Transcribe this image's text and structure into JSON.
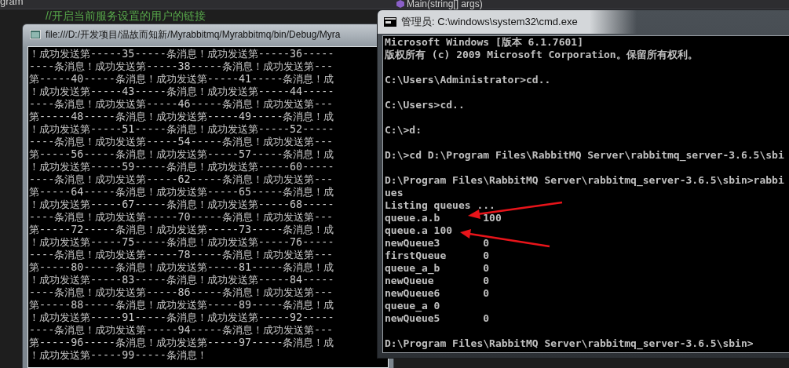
{
  "ide": {
    "tab_label": "gram",
    "member_dropdown": "Main(string[] args)",
    "code_comment": "//开启当前服务设置的用户的链接"
  },
  "app_console": {
    "title": "file:///D:/开发项目/温故而知新/Myrabbitmq/Myrabbitmq/bin/Debug/Myra",
    "lines": [
      "！成功发送第-----35-----条消息！成功发送第-----36-----",
      "----条消息！成功发送第-----38-----条消息！成功发送第---",
      "第-----40-----条消息！成功发送第-----41-----条消息！成",
      "！成功发送第-----43-----条消息！成功发送第-----44-----",
      "----条消息！成功发送第-----46-----条消息！成功发送第---",
      "第-----48-----条消息！成功发送第-----49-----条消息！成",
      "！成功发送第-----51-----条消息！成功发送第-----52-----",
      "----条消息！成功发送第-----54-----条消息！成功发送第---",
      "第-----56-----条消息！成功发送第-----57-----条消息！成",
      "！成功发送第-----59-----条消息！成功发送第-----60-----",
      "----条消息！成功发送第-----62-----条消息！成功发送第---",
      "第-----64-----条消息！成功发送第-----65-----条消息！成",
      "！成功发送第-----67-----条消息！成功发送第-----68-----",
      "----条消息！成功发送第-----70-----条消息！成功发送第---",
      "第-----72-----条消息！成功发送第-----73-----条消息！成",
      "！成功发送第-----75-----条消息！成功发送第-----76-----",
      "----条消息！成功发送第-----78-----条消息！成功发送第---",
      "第-----80-----条消息！成功发送第-----81-----条消息！成",
      "！成功发送第-----83-----条消息！成功发送第-----84-----",
      "----条消息！成功发送第-----86-----条消息！成功发送第---",
      "第-----88-----条消息！成功发送第-----89-----条消息！成",
      "！成功发送第-----91-----条消息！成功发送第-----92-----",
      "----条消息！成功发送第-----94-----条消息！成功发送第---",
      "第-----96-----条消息！成功发送第-----97-----条消息！成",
      "！成功发送第-----99-----条消息！"
    ]
  },
  "cmd": {
    "title": "管理员: C:\\windows\\system32\\cmd.exe",
    "blocks": [
      [
        "Microsoft Windows [版本 6.1.7601]",
        "版权所有 (c) 2009 Microsoft Corporation。保留所有权利。"
      ],
      [
        "C:\\Users\\Administrator>cd.."
      ],
      [
        "C:\\Users>cd.."
      ],
      [
        "C:\\>d:"
      ],
      [
        "D:\\>cd D:\\Program Files\\RabbitMQ Server\\rabbitmq_server-3.6.5\\sbi"
      ],
      [
        "D:\\Program Files\\RabbitMQ Server\\rabbitmq_server-3.6.5\\sbin>rabbi",
        "ues",
        "Listing queues ...",
        "queue.a.b       100",
        "queue.a 100",
        "newQueue3       0",
        "firstQueue      0",
        "queue_a_b       0",
        "newQueue        0",
        "newQueue6       0",
        "queue_a 0",
        "newQueue5       0"
      ],
      [
        "D:\\Program Files\\RabbitMQ Server\\rabbitmq_server-3.6.5\\sbin>"
      ]
    ]
  }
}
